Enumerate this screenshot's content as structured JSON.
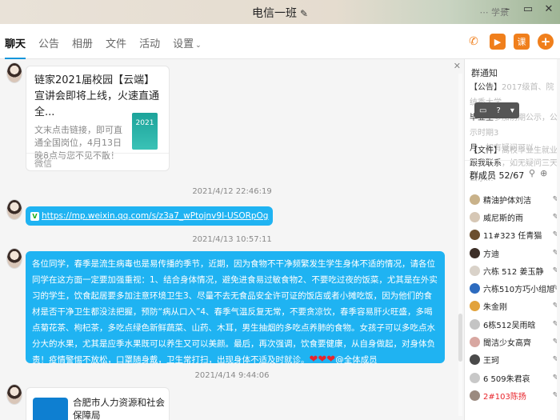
{
  "window": {
    "title": "电信一班",
    "faint_text": "⋯ 学景"
  },
  "tabs": [
    {
      "label": "聊天",
      "active": true
    },
    {
      "label": "公告"
    },
    {
      "label": "相册"
    },
    {
      "label": "文件"
    },
    {
      "label": "活动"
    },
    {
      "label": "设置",
      "dropdown": true
    }
  ],
  "toolbar": {
    "app_label": "课",
    "add_label": "+"
  },
  "colors": {
    "accent_orange": "#f07f1c",
    "bubble_blue": "#1fb3f2",
    "tab_underline": "#1296db"
  },
  "messages": {
    "card1": {
      "title": "链家2021届校园【云端】宣讲会即将上线，火速直通全...",
      "desc": "文末点击链接，即可直通全国岗位，4月13日晚8点与您不见不散！",
      "thumb_text": "2021",
      "source": "微信"
    },
    "time1": "2021/4/12 22:46:19",
    "link": {
      "icon": "V",
      "url": "https://mp.weixin.qq.com/s/z3a7_wPtojnv9I-USORpOg"
    },
    "time2": "2021/4/13 10:57:11",
    "notice": {
      "text": "各位同学，春季是流生病毒也是易传播的季节，近期，因为食物不干净频繁发生学生身体不适的情况，请各位同学在这方面一定要加强重视：1、结合身体情况，避免进食易过敏食物2、不要吃过夜的饭菜，尤其是在外实习的学生，饮食起居要多加注意环境卫生3、尽量不去无食品安全许可证的饭店或者小摊吃饭，因为他们的食材是否干净卫生都没法把握，预防“病从口入”4、春季气温反复无常，不要贪凉饮，春季容易肝火旺盛，多喝点菊花茶、枸杞茶，多吃点绿色新鲜蔬菜、山药、木耳，男生抽烟的多吃点养肺的食物。女孩子可以多吃点水分大的水果，尤其是应季水果既可以养生又可以美颜。最后，再次强调，饮食要健康，从自身做起，对身体负责！疫情警惕不放松，口罩随身戴，卫生常打扫，出现身体不适及时就诊。",
      "hearts": "❤❤❤",
      "mention": "@全体成员"
    },
    "time3": "2021/4/14 9:44:06",
    "card2": {
      "title": "合肥市人力资源和社会保障局"
    }
  },
  "sidebar": {
    "notice_title": "群通知",
    "notice_lines": [
      {
        "prefix": "【公告】",
        "rest": "2017级首、院统秀大学"
      },
      {
        "prefix": "毕业生",
        "rest": "参加前期公示，公示时期3"
      },
      {
        "prefix": "月",
        "rest": "，如有疑问可以"
      },
      {
        "prefix": "跟我联系",
        "rest": "，如无疑问三天公示..."
      }
    ],
    "file_prefix": "【文件】",
    "file_rest": "高校毕业生就业创业政...",
    "overlay_icons": [
      "▭",
      "?",
      "▾"
    ],
    "members_title": "群成员 52/67",
    "members_icons": [
      "⚲",
      "⊕"
    ],
    "members": [
      {
        "name": "精油护体刘洁",
        "avatar_color": "#c9b28a",
        "action": "✎"
      },
      {
        "name": "威尼斯的雨",
        "avatar_color": "#d6c7b5",
        "action": "✎"
      },
      {
        "name": "11#323 任青猫",
        "avatar_color": "#6b4e2e",
        "action": "✎"
      },
      {
        "name": "方迪",
        "avatar_color": "#3d2f28",
        "action": "✎"
      },
      {
        "name": "六栋 512 姜玉静",
        "avatar_color": "#d9d2c9",
        "action": "✎"
      },
      {
        "name": "六栋510方巧小组旭",
        "avatar_color": "#2d6bbf",
        "action": "✎"
      },
      {
        "name": "朱金刚",
        "avatar_color": "#e2a23b",
        "action": "✎"
      },
      {
        "name": "6栋512吴雨晗",
        "avatar_color": "#c4c4c4",
        "action": "✎"
      },
      {
        "name": "聞洁少女高齊",
        "avatar_color": "#d8a7a1",
        "action": "✎"
      },
      {
        "name": "王珂",
        "avatar_color": "#4a4a4a",
        "action": "✎"
      },
      {
        "name": "6 509朱君哀",
        "avatar_color": "#c8c8c8",
        "action": "✎"
      },
      {
        "name": "2#103陈扬",
        "avatar_color": "#9b8a7f",
        "action": "✎",
        "red": true
      }
    ]
  }
}
